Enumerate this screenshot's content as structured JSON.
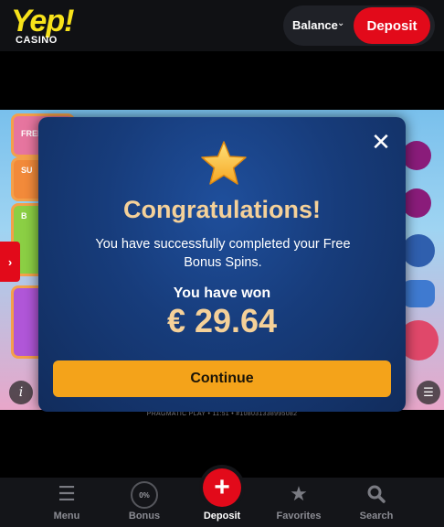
{
  "header": {
    "logo_text": "Yep!",
    "logo_sub": "CASINO",
    "balance_label": "Balance",
    "balance_chevron": "chevron-down-icon",
    "deposit_label": "Deposit"
  },
  "game": {
    "tiles": [
      {
        "label": "FREE"
      },
      {
        "label": "SU"
      },
      {
        "label": "B"
      }
    ],
    "provider_line": "PRAGMATIC PLAY • 11:51 • #108031338995082",
    "info_icon": "info-icon",
    "menu_icon": "menu-icon"
  },
  "modal": {
    "star_icon": "star-icon",
    "close_icon": "close-icon",
    "title": "Congratulations!",
    "message": "You have successfully completed your Free Bonus Spins.",
    "won_label": "You have won",
    "won_amount": "€ 29.64",
    "continue_label": "Continue"
  },
  "bottom_nav": {
    "items": [
      {
        "label": "Menu",
        "icon": "hamburger-icon"
      },
      {
        "label": "Bonus",
        "icon": "bonus-progress-icon",
        "progress_text": "0%"
      },
      {
        "label": "Deposit",
        "icon": "plus-icon"
      },
      {
        "label": "Favorites",
        "icon": "star-icon"
      },
      {
        "label": "Search",
        "icon": "search-icon"
      }
    ]
  },
  "colors": {
    "accent_red": "#e20a1a",
    "continue_orange": "#f4a31a",
    "modal_blue": "#173c7b",
    "title_gold": "#f5d199",
    "logo_yellow": "#f7e21a"
  }
}
